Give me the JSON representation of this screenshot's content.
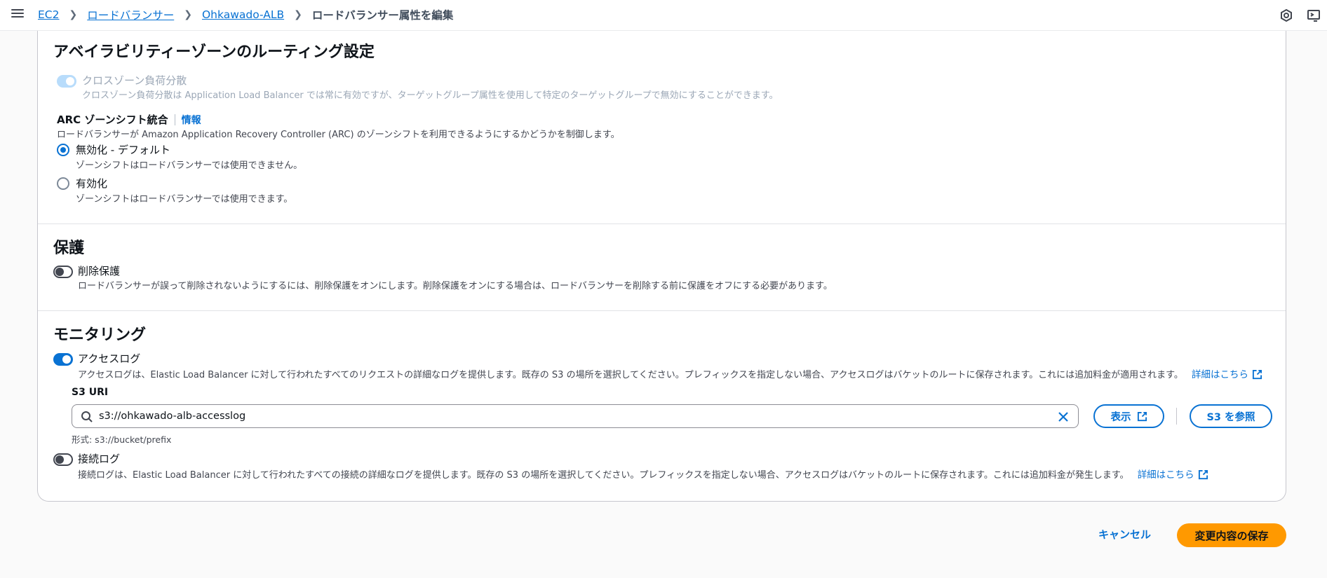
{
  "breadcrumb": {
    "items": [
      "EC2",
      "ロードバランサー",
      "Ohkawado-ALB"
    ],
    "current": "ロードバランサー属性を編集"
  },
  "icons": {
    "menu": "hamburger-menu-icon",
    "notifications": "notification-icon",
    "cloudshell": "cloudshell-icon"
  },
  "az_routing": {
    "title": "アベイラビリティーゾーンのルーティング設定",
    "cross_zone": {
      "label": "クロスゾーン負荷分散",
      "desc": "クロスゾーン負荷分散は Application Load Balancer では常に有効ですが、ターゲットグループ属性を使用して特定のターゲットグループで無効にすることができます。",
      "enabled": true,
      "disabled": true
    },
    "arc": {
      "label": "ARC ゾーンシフト統合",
      "info": "情報",
      "desc": "ロードバランサーが Amazon Application Recovery Controller (ARC) のゾーンシフトを利用できるようにするかどうかを制御します。",
      "options": [
        {
          "label": "無効化 - デフォルト",
          "desc": "ゾーンシフトはロードバランサーでは使用できません。",
          "selected": true
        },
        {
          "label": "有効化",
          "desc": "ゾーンシフトはロードバランサーでは使用できます。",
          "selected": false
        }
      ]
    }
  },
  "protection": {
    "title": "保護",
    "deletion": {
      "label": "削除保護",
      "desc": "ロードバランサーが誤って削除されないようにするには、削除保護をオンにします。削除保護をオンにする場合は、ロードバランサーを削除する前に保護をオフにする必要があります。",
      "enabled": false
    }
  },
  "monitoring": {
    "title": "モニタリング",
    "access_log": {
      "label": "アクセスログ",
      "desc": "アクセスログは、Elastic Load Balancer に対して行われたすべてのリクエストの詳細なログを提供します。既存の S3 の場所を選択してください。プレフィックスを指定しない場合、アクセスログはバケットのルートに保存されます。これには追加料金が適用されます。",
      "learn_more": "詳細はこちら",
      "enabled": true
    },
    "s3_uri": {
      "label": "S3 URI",
      "value": "s3://ohkawado-alb-accesslog",
      "hint": "形式: s3://bucket/prefix",
      "view_button": "表示",
      "browse_button": "S3 を参照"
    },
    "connection_log": {
      "label": "接続ログ",
      "desc": "接続ログは、Elastic Load Balancer に対して行われたすべての接続の詳細なログを提供します。既存の S3 の場所を選択してください。プレフィックスを指定しない場合、アクセスログはバケットのルートに保存されます。これには追加料金が発生します。",
      "learn_more": "詳細はこちら",
      "enabled": false
    }
  },
  "actions": {
    "cancel": "キャンセル",
    "save": "変更内容の保存"
  },
  "colors": {
    "primary": "#0972d3",
    "save_button": "#ff9900",
    "toggle_disabled": "#b8dcfb"
  }
}
